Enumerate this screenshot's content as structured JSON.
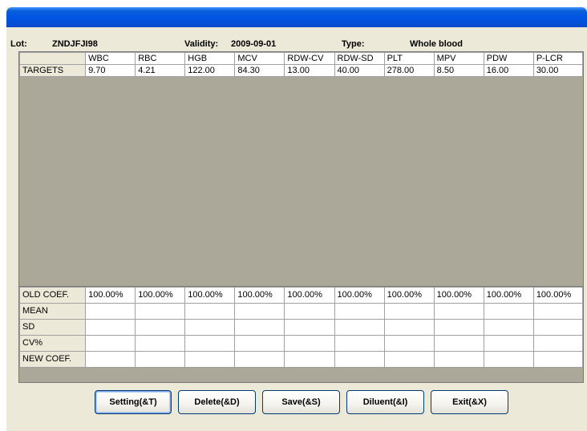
{
  "header": {
    "lot_label": "Lot:",
    "lot_value": "ZNDJFJI98",
    "validity_label": "Validity:",
    "validity_value": "2009-09-01",
    "type_label": "Type:",
    "type_value": "Whole blood"
  },
  "targets_table": {
    "columns": [
      "WBC",
      "RBC",
      "HGB",
      "MCV",
      "RDW-CV",
      "RDW-SD",
      "PLT",
      "MPV",
      "PDW",
      "P-LCR"
    ],
    "row_label": "TARGETS",
    "values": [
      "9.70",
      "4.21",
      "122.00",
      "84.30",
      "13.00",
      "40.00",
      "278.00",
      "8.50",
      "16.00",
      "30.00"
    ]
  },
  "coef_table": {
    "rows": [
      {
        "label": "OLD COEF.",
        "values": [
          "100.00%",
          "100.00%",
          "100.00%",
          "100.00%",
          "100.00%",
          "100.00%",
          "100.00%",
          "100.00%",
          "100.00%",
          "100.00%"
        ]
      },
      {
        "label": "MEAN",
        "values": [
          "",
          "",
          "",
          "",
          "",
          "",
          "",
          "",
          "",
          ""
        ]
      },
      {
        "label": "SD",
        "values": [
          "",
          "",
          "",
          "",
          "",
          "",
          "",
          "",
          "",
          ""
        ]
      },
      {
        "label": "CV%",
        "values": [
          "",
          "",
          "",
          "",
          "",
          "",
          "",
          "",
          "",
          ""
        ]
      },
      {
        "label": "NEW COEF.",
        "values": [
          "",
          "",
          "",
          "",
          "",
          "",
          "",
          "",
          "",
          ""
        ]
      }
    ]
  },
  "buttons": {
    "setting": "Setting(&T)",
    "delete": "Delete(&D)",
    "save": "Save(&S)",
    "diluent": "Diluent(&I)",
    "exit": "Exit(&X)"
  },
  "colors": {
    "titlebar": "#0054e3",
    "window_bg": "#ece9d8",
    "grid_bg": "#aca899"
  }
}
